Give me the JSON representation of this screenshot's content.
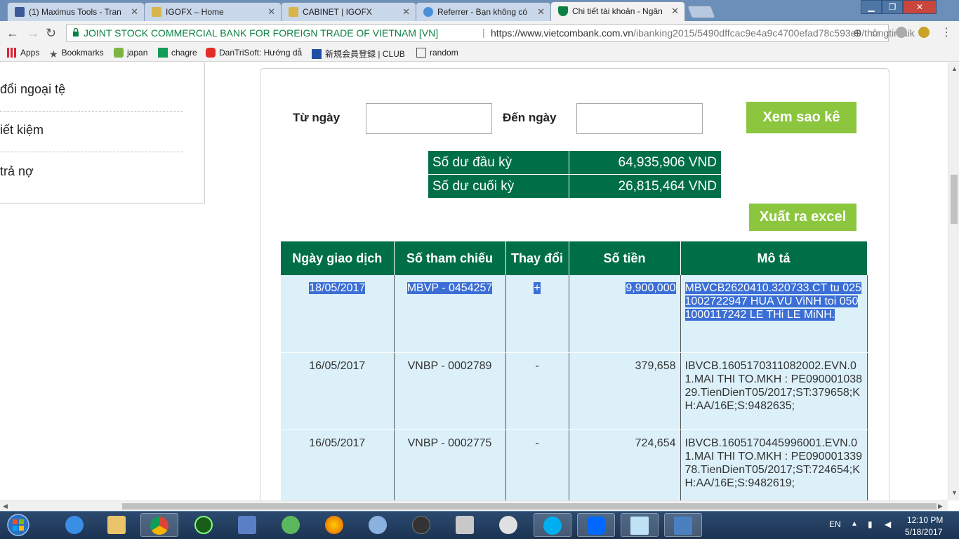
{
  "browser": {
    "tabs": [
      {
        "title": "(1) Maximus Tools - Tran",
        "icon": "facebook-icon",
        "color": "#3b5998"
      },
      {
        "title": "IGOFX – Home",
        "icon": "page-icon",
        "color": "#d9b44a"
      },
      {
        "title": "CABINET | IGOFX",
        "icon": "page-icon",
        "color": "#d9b44a"
      },
      {
        "title": "Referrer - Bạn không có",
        "icon": "globe-icon",
        "color": "#4a90d9"
      },
      {
        "title": "Chi tiết tài khoản - Ngân",
        "icon": "vcb-shield-icon",
        "color": "#0b8043",
        "active": true
      }
    ],
    "window_controls": {
      "minimize": "▁",
      "restore": "❐",
      "close": "✕"
    },
    "address": {
      "org": "JOINT STOCK COMMERCIAL BANK FOR FOREIGN TRADE OF VIETNAM [VN]",
      "separator": "|",
      "url_host": "https://www.vietcombank.com.vn",
      "url_path": "/ibanking2015/5490dffcac9e4a9c4700efad78c593e9/thongtintaik"
    },
    "nav": {
      "back": "←",
      "forward": "→",
      "reload": "↻",
      "zoom": "⊕",
      "star": "☆"
    },
    "bookmarks": [
      {
        "label": "Apps",
        "icon": "apps-grid-icon"
      },
      {
        "label": "Bookmarks",
        "icon": "star-icon"
      },
      {
        "label": "japan",
        "icon": "map-pin-icon"
      },
      {
        "label": "chagre",
        "icon": "sheet-icon"
      },
      {
        "label": "DanTriSoft: Hướng dẫ",
        "icon": "youtube-icon"
      },
      {
        "label": "新規会員登録 | CLUB",
        "icon": "p-logo-icon"
      },
      {
        "label": "random",
        "icon": "page-icon"
      }
    ]
  },
  "sidebar": {
    "items": [
      {
        "label": "đổi ngoại tệ"
      },
      {
        "label": "iết kiệm"
      },
      {
        "label": "trả nợ"
      }
    ]
  },
  "filter": {
    "from_label": "Từ ngày",
    "to_label": "Đến ngày",
    "from_value": "",
    "to_value": "",
    "view_button": "Xem sao kê"
  },
  "balance": {
    "opening_label": "Số dư đầu kỳ",
    "opening_value": "64,935,906 VND",
    "closing_label": "Số dư cuối kỳ",
    "closing_value": "26,815,464 VND"
  },
  "export_button": "Xuất ra excel",
  "table": {
    "headers": [
      "Ngày giao dịch",
      "Số tham chiếu",
      "Thay đổi",
      "Số tiền",
      "Mô tả"
    ],
    "rows": [
      {
        "date": "18/05/2017",
        "ref": "MBVP - 0454257",
        "change": "+",
        "amount": "9,900,000",
        "desc": "MBVCB2620410.320733.CT tu 0251002722947 HUA VU ViNH toi 0501000117242 LE THi LE MiNH.",
        "selected": true
      },
      {
        "date": "16/05/2017",
        "ref": "VNBP - 0002789",
        "change": "-",
        "amount": "379,658",
        "desc": "IBVCB.1605170311082002.EVN.01.MAI THI TO.MKH : PE09000103829.TienDienT05/2017;ST:379658;KH:AA/16E;S:9482635;"
      },
      {
        "date": "16/05/2017",
        "ref": "VNBP - 0002775",
        "change": "-",
        "amount": "724,654",
        "desc": "IBVCB.1605170445996001.EVN.01.MAI THI TO.MKH : PE09000133978.TienDienT05/2017;ST:724654;KH:AA/16E;S:9482619;"
      }
    ]
  },
  "taskbar": {
    "apps": [
      "ie-icon",
      "explorer-icon",
      "chrome-icon",
      "green-orb-icon",
      "network-icon",
      "arrows-icon",
      "firefox-icon",
      "thunderbird-icon",
      "nox-icon",
      "tools-icon",
      "eye-icon",
      "skype-icon",
      "zalo-icon",
      "notepad-icon",
      "remote-icon"
    ],
    "lang": "EN",
    "time": "12:10 PM",
    "date": "5/18/2017",
    "colors": {
      "accent": "#006f47",
      "button": "#8cc63f",
      "selection": "#3b6fd6",
      "row": "#dcf0f9"
    }
  }
}
